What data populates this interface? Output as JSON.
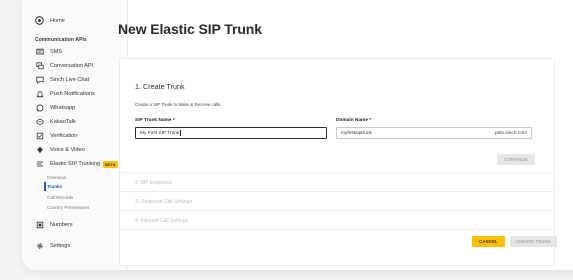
{
  "sidebar": {
    "home_label": "Home",
    "section_title": "Communication APIs",
    "items": [
      {
        "label": "SMS",
        "icon": "sms-icon"
      },
      {
        "label": "Conversation API",
        "icon": "conversation-icon"
      },
      {
        "label": "Sinch Live Chat",
        "icon": "live-chat-icon"
      },
      {
        "label": "Push Notifications",
        "icon": "bell-icon"
      },
      {
        "label": "Whatsapp",
        "icon": "whatsapp-icon"
      },
      {
        "label": "KakaoTalk",
        "icon": "kakaotalk-icon"
      },
      {
        "label": "Verification",
        "icon": "verification-icon"
      },
      {
        "label": "Voice & Video",
        "icon": "voice-icon"
      },
      {
        "label": "Elastic SIP Trunking",
        "icon": "sip-icon",
        "badge": "BETA"
      }
    ],
    "sub_items": [
      {
        "label": "Overview"
      },
      {
        "label": "Trunks",
        "active": true
      },
      {
        "label": "Call Records"
      },
      {
        "label": "Country Permissions"
      }
    ],
    "numbers_label": "Numbers",
    "settings_label": "Settings"
  },
  "page": {
    "title": "New Elastic SIP Trunk"
  },
  "step1": {
    "title": "1. Create Trunk",
    "description": "Create a SIP Trunk to Make & Receive calls.",
    "trunk_name_label": "SIP Trunk Name *",
    "trunk_name_value": "My First SIP Trunk",
    "domain_name_label": "Domain Name *",
    "domain_name_value": "myfirstsiptrunk",
    "domain_suffix": ".pstn.sinch.com",
    "continue_label": "CONTINUE"
  },
  "steps": [
    {
      "title": "2. SIP Endpoints"
    },
    {
      "title": "3. Outbound Call Settings"
    },
    {
      "title": "4. Inbound Call Settings"
    }
  ],
  "footer": {
    "cancel_label": "CANCEL",
    "create_label": "CREATE TRUNK"
  },
  "colors": {
    "accent": "#ffc107",
    "active_link": "#1b5ea8"
  }
}
